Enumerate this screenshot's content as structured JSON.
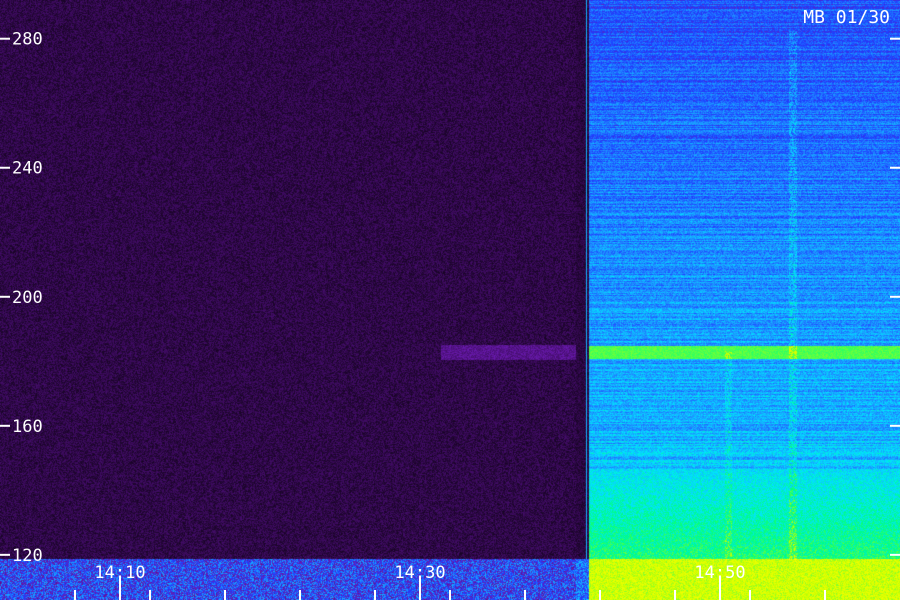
{
  "chart_data": {
    "type": "heatmap",
    "title": "MB 01/30",
    "y_ticks": [
      120,
      160,
      200,
      240,
      280
    ],
    "y_tick_labels": [
      "120",
      "160",
      "200",
      "240",
      "280"
    ],
    "ylim": [
      106,
      292
    ],
    "x_tick_labels": [
      "14:10",
      "14:30",
      "14:50"
    ],
    "x_tick_minutes": [
      10,
      30,
      50
    ],
    "xlim_minutes": [
      2,
      62
    ],
    "minor_tick_minutes": [
      7,
      12,
      17,
      22,
      27,
      32,
      37,
      42,
      47,
      52,
      57
    ],
    "regions": [
      {
        "start_min": 2,
        "end_min": 40.4,
        "state": "quiet",
        "level": 0.05
      },
      {
        "start_min": 40.4,
        "end_min": 41.3,
        "state": "transition",
        "level": 0.5
      },
      {
        "start_min": 41.3,
        "end_min": 62,
        "state": "active",
        "level": 0.55
      }
    ],
    "bands": [
      {
        "freq": 183,
        "width": 4,
        "level": 0.8,
        "region": "active"
      },
      {
        "freq": 183,
        "width": 4,
        "level": 0.12,
        "region": "quiet"
      }
    ],
    "colormap": [
      "#000000",
      "#3a0a5a",
      "#6a1ab0",
      "#1e3cff",
      "#1e90ff",
      "#00e5ff",
      "#00ff7f",
      "#c8ff00",
      "#ffff00"
    ]
  }
}
